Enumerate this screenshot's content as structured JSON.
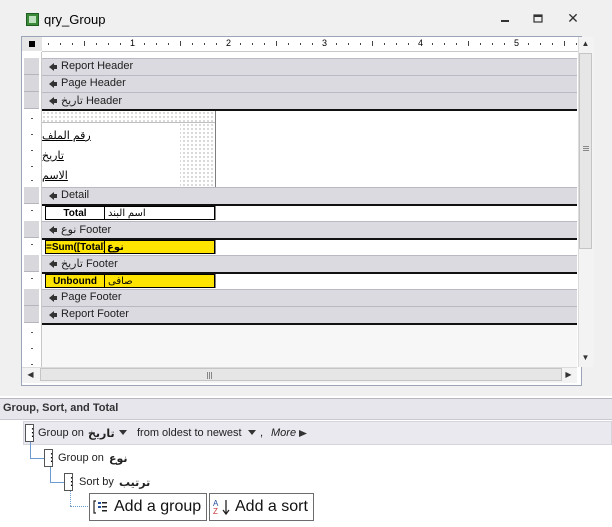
{
  "window": {
    "title": "qry_Group",
    "min_glyph": "▭",
    "max_glyph": "▣",
    "close_glyph": "✕"
  },
  "ruler": {
    "numbers": [
      "1",
      "2",
      "3",
      "4",
      "5"
    ]
  },
  "sections": {
    "report_header": "Report Header",
    "page_header": "Page Header",
    "date_header": "تاريخ Header",
    "detail": "Detail",
    "type_footer": "نوع Footer",
    "date_footer": "تاريخ Footer",
    "page_footer": "Page Footer",
    "report_footer": "Report Footer"
  },
  "header_labels": {
    "file_number": "رقم الملف",
    "date": "تاريخ",
    "name": "الاسم"
  },
  "detail_fields": {
    "total": "Total",
    "item_name": "اسم البند"
  },
  "type_footer_fields": {
    "sum_total": "=Sum([Total])",
    "type": "نوع"
  },
  "date_footer_fields": {
    "unbound": "Unbound",
    "net": "صافى"
  },
  "group_pane": {
    "title": "Group, Sort, and Total",
    "row1": {
      "prefix": "Group on",
      "field": "تاريخ",
      "order": "from oldest to newest",
      "more": "More"
    },
    "row2": {
      "prefix": "Group on",
      "field": "نوع"
    },
    "row3": {
      "prefix": "Sort by",
      "field": "ترتيب"
    },
    "add_group": "Add a group",
    "add_sort": "Add a sort"
  },
  "colors": {
    "yellow_field": "#ffe400",
    "band": "#dadae0",
    "connector": "#6b9bd1"
  },
  "icons": [
    "app-icon",
    "section-arrow-icon",
    "dropdown-icon",
    "more-arrow-icon",
    "add-group-icon",
    "add-sort-icon"
  ]
}
